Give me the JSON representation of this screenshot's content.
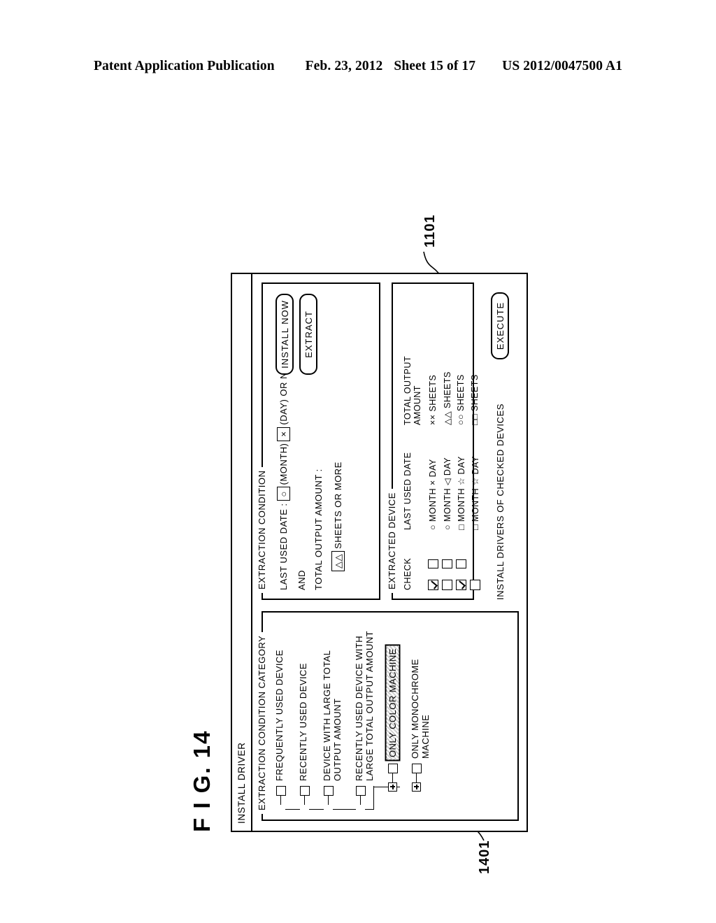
{
  "patent_header": {
    "publication": "Patent Application Publication",
    "date": "Feb. 23, 2012",
    "sheet": "Sheet 15 of 17",
    "number": "US 2012/0047500 A1"
  },
  "figure": {
    "label": "F I G. 14",
    "reference_callouts": [
      {
        "id": "ref-1101",
        "text": "1101"
      },
      {
        "id": "ref-1401",
        "text": "1401"
      }
    ]
  },
  "window": {
    "title": "INSTALL DRIVER"
  },
  "category_panel": {
    "legend": "EXTRACTION CONDITION CATEGORY",
    "items": [
      {
        "label": "FREQUENTLY USED DEVICE",
        "checked": false,
        "selected": false
      },
      {
        "label": "RECENTLY USED DEVICE",
        "checked": false,
        "selected": false
      },
      {
        "label": "DEVICE WITH LARGE TOTAL\nOUTPUT AMOUNT",
        "checked": false,
        "selected": false
      },
      {
        "label": "RECENTLY USED DEVICE WITH\nLARGE TOTAL OUTPUT AMOUNT",
        "checked": false,
        "selected": false
      },
      {
        "label": "ONLY COLOR MACHINE",
        "checked": false,
        "selected": true
      },
      {
        "label": "ONLY MONOCHROME\nMACHINE",
        "checked": false,
        "selected": false
      }
    ]
  },
  "condition_panel": {
    "legend": "EXTRACTION CONDITION",
    "last_used_date_label": "LAST USED DATE :",
    "month_value": "○",
    "month_unit": "(MONTH)",
    "day_value": "×",
    "day_unit": "(DAY) OR NEWER",
    "and_label": "AND",
    "total_output_label": "TOTAL OUTPUT AMOUNT :",
    "sheets_value": "△△",
    "sheets_unit": "SHEETS OR MORE",
    "install_now_button": "INSTALL NOW",
    "extract_button": "EXTRACT"
  },
  "extracted_panel": {
    "legend": "EXTRACTED DEVICE",
    "columns": [
      "CHECK",
      "LAST USED DATE",
      "TOTAL OUTPUT AMOUNT"
    ],
    "rows": [
      {
        "checked": true,
        "secondary_box": true,
        "date": "○ MONTH × DAY",
        "amount": "×× SHEETS"
      },
      {
        "checked": false,
        "secondary_box": true,
        "date": "○ MONTH ◁ DAY",
        "amount": "△△ SHEETS"
      },
      {
        "checked": true,
        "secondary_box": true,
        "date": "□ MONTH ☆ DAY",
        "amount": "○○ SHEETS"
      },
      {
        "checked": false,
        "secondary_box": false,
        "date": "□ MONTH ☆ DAY",
        "amount": "□□ SHEETS"
      }
    ]
  },
  "install_bar": {
    "text": "INSTALL DRIVERS OF CHECKED DEVICES",
    "execute_button": "EXECUTE"
  }
}
